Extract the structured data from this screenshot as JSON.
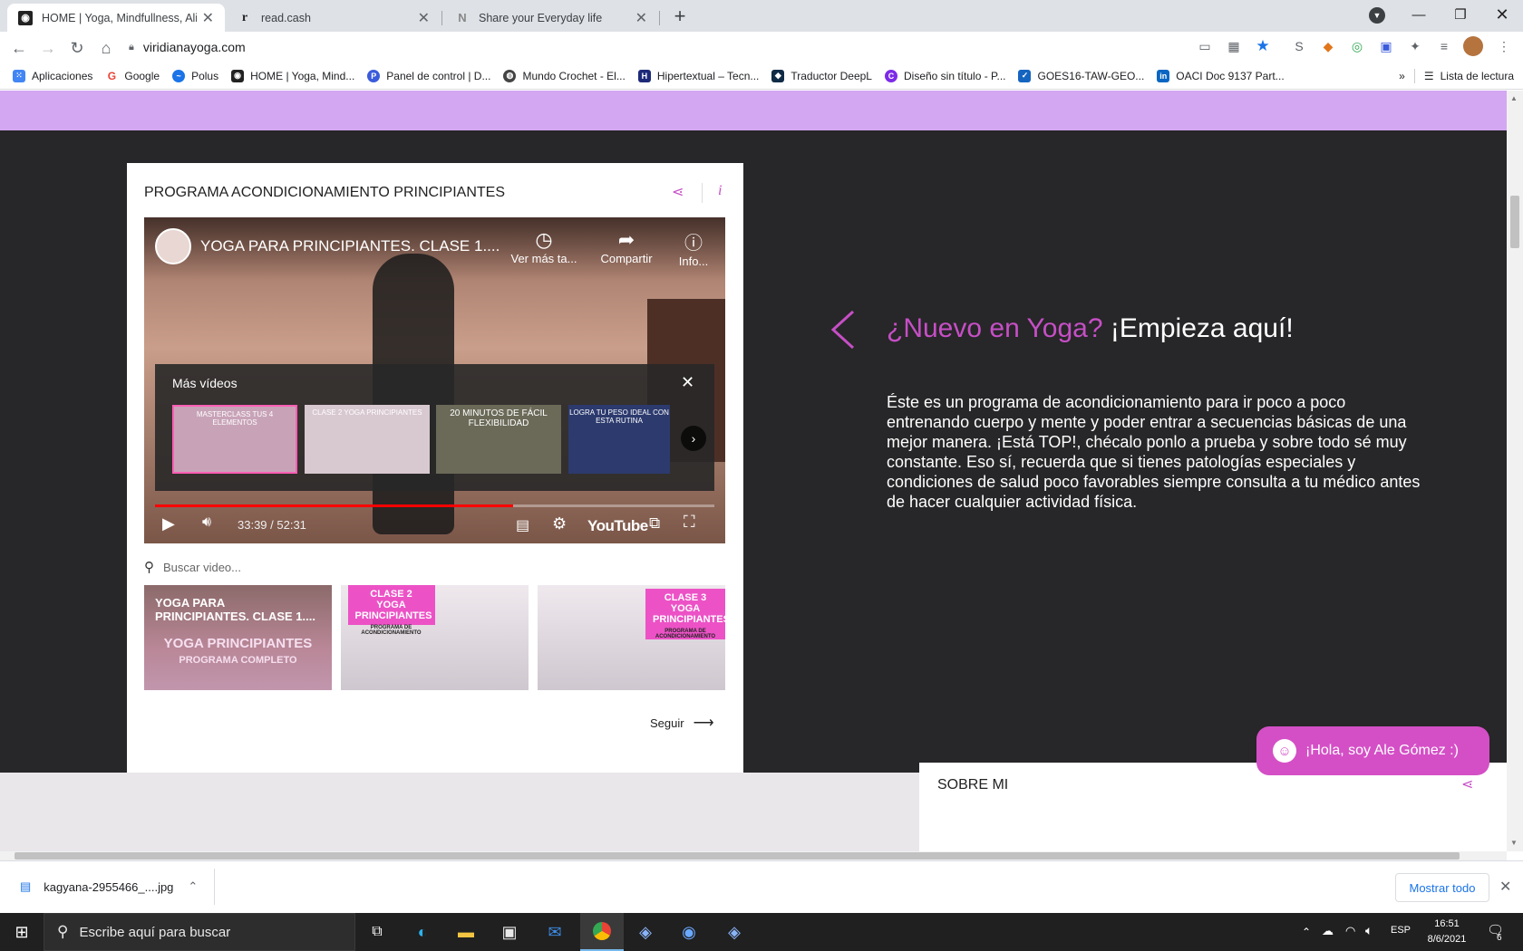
{
  "tabs": [
    {
      "title": "HOME | Yoga, Mindfullness, Alim",
      "favicon": "yoga-icon",
      "active": true
    },
    {
      "title": "read.cash",
      "favicon": "r-icon",
      "active": false
    },
    {
      "title": "Share your Everyday life",
      "favicon": "noise-icon",
      "active": false
    }
  ],
  "toolbar": {
    "url": "viridianayoga.com"
  },
  "bookmarks": [
    {
      "label": "Aplicaciones",
      "icon": "apps-grid-icon",
      "color": "#4285f4"
    },
    {
      "label": "Google",
      "icon": "google-icon",
      "color": "#ea4335"
    },
    {
      "label": "Polus",
      "icon": "polus-icon",
      "color": "#1a73e8"
    },
    {
      "label": "HOME | Yoga, Mind...",
      "icon": "yoga-icon",
      "color": "#222222"
    },
    {
      "label": "Panel de control | D...",
      "icon": "panel-icon",
      "color": "#3b5bdb"
    },
    {
      "label": "Mundo Crochet - El...",
      "icon": "crochet-icon",
      "color": "#444444"
    },
    {
      "label": "Hipertextual – Tecn...",
      "icon": "hipertextual-icon",
      "color": "#1e2a78"
    },
    {
      "label": "Traductor DeepL",
      "icon": "deepl-icon",
      "color": "#0f2b46"
    },
    {
      "label": "Diseño sin título - P...",
      "icon": "canva-icon",
      "color": "#7d2ae8"
    },
    {
      "label": "GOES16-TAW-GEO...",
      "icon": "goes-icon",
      "color": "#1565c0"
    },
    {
      "label": "OACI Doc 9137 Part...",
      "icon": "linkedin-icon",
      "color": "#0a66c2"
    }
  ],
  "reading_list": "Lista de lectura",
  "widget": {
    "title": "PROGRAMA ACONDICIONAMIENTO PRINCIPIANTES",
    "video": {
      "title": "YOGA PARA PRINCIPIANTES. CLASE 1....",
      "watch_later": "Ver más ta...",
      "share": "Compartir",
      "info": "Info...",
      "more_videos": "Más vídeos",
      "time": "33:39 / 52:31",
      "progress": 0.64,
      "youtube_label": "YouTube",
      "more_thumbs": [
        {
          "label": "MASTERCLASS TUS 4 ELEMENTOS"
        },
        {
          "label": "CLASE 2 YOGA PRINCIPIANTES"
        },
        {
          "label": "20 MINUTOS DE FÁCIL FLEXIBILIDAD"
        },
        {
          "label": "LOGRA TU PESO IDEAL CON ESTA RUTINA"
        }
      ]
    },
    "search_placeholder": "Buscar video...",
    "thumbs": [
      {
        "top": "YOGA PARA PRINCIPIANTES. CLASE 1....",
        "bottom": "YOGA PRINCIPIANTES",
        "sub": "PROGRAMA COMPLETO"
      },
      {
        "top": "CLASE 2 YOGA PRINCIPIANTES",
        "bottom": "",
        "sub": "PROGRAMA DE ACONDICIONAMIENTO"
      },
      {
        "top": "CLASE 3 YOGA PRINCIPIANTES",
        "bottom": "",
        "sub": "PROGRAMA DE ACONDICIONAMIENTO"
      }
    ],
    "follow": "Seguir"
  },
  "hero": {
    "heading_accent": "¿Nuevo en Yoga?",
    "heading_rest": " ¡Empieza aquí!",
    "body": "Éste es un programa de acondicionamiento para ir poco a poco entrenando cuerpo y mente y poder entrar a secuencias básicas de una mejor manera. ¡Está TOP!, chécalo ponlo a prueba y sobre todo sé muy constante. Eso sí, recuerda que si tienes patologías especiales y condiciones de salud poco favorables siempre consulta a tu médico antes de hacer cualquier actividad física."
  },
  "sobre_mi": "SOBRE MI",
  "chat": "¡Hola, soy Ale Gómez :)",
  "download": {
    "file": "kagyana-2955466_....jpg",
    "show_all": "Mostrar todo"
  },
  "taskbar": {
    "search": "Escribe aquí para buscar",
    "lang": "ESP",
    "time": "16:51",
    "date": "8/6/2021",
    "notifications": "6"
  },
  "colors": {
    "accent": "#c64fc6",
    "purple_band": "#d3a7f2",
    "dark": "#272628",
    "chat": "#d44fc6"
  }
}
